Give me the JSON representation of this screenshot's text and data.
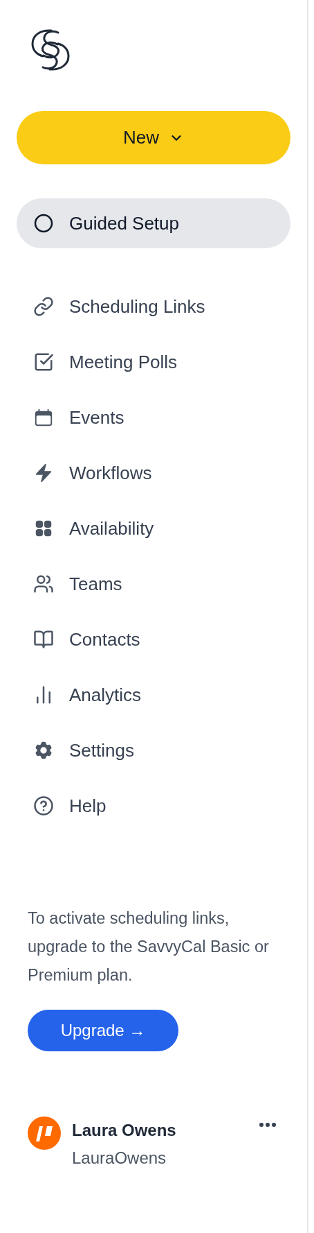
{
  "new_button": {
    "label": "New"
  },
  "nav": [
    {
      "label": "Guided Setup",
      "kind": "setup",
      "selected": true
    },
    {
      "label": "Scheduling Links",
      "kind": "link",
      "selected": false
    },
    {
      "label": "Meeting Polls",
      "kind": "link",
      "selected": false
    },
    {
      "label": "Events",
      "kind": "link",
      "selected": false
    },
    {
      "label": "Workflows",
      "kind": "link",
      "selected": false
    },
    {
      "label": "Availability",
      "kind": "link",
      "selected": false
    },
    {
      "label": "Teams",
      "kind": "link",
      "selected": false
    },
    {
      "label": "Contacts",
      "kind": "link",
      "selected": false
    },
    {
      "label": "Analytics",
      "kind": "link",
      "selected": false
    },
    {
      "label": "Settings",
      "kind": "link",
      "selected": false
    },
    {
      "label": "Help",
      "kind": "link",
      "selected": false
    }
  ],
  "upgrade": {
    "message": "To activate scheduling links, upgrade to the SavvyCal Basic or Premium plan.",
    "button": "Upgrade →"
  },
  "user": {
    "name": "Laura Owens",
    "username": "LauraOwens"
  }
}
